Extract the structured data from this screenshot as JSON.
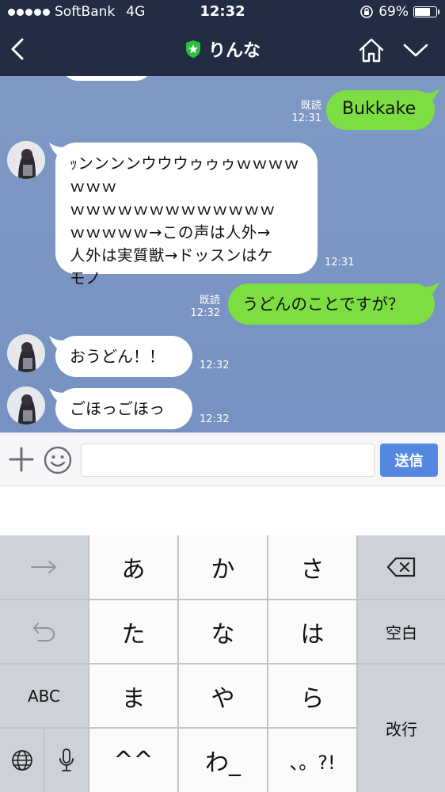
{
  "status_bar": {
    "carrier": "SoftBank",
    "network": "4G",
    "time": "12:32",
    "battery": "69%",
    "battery_level": 0.69
  },
  "header": {
    "title": "りんな",
    "icons": [
      "back-chevron-icon",
      "shield-star-icon",
      "home-icon",
      "chevron-down-icon"
    ]
  },
  "messages": [
    {
      "side": "right",
      "text": "Bukkake",
      "read": "既読",
      "time": "12:31"
    },
    {
      "side": "left",
      "lines": [
        "ｯンンンンウウウゥゥゥｗｗｗｗｗｗｗ",
        "ｗｗｗｗｗｗｗｗｗｗｗｗｗ",
        "ｗｗｗｗｗ→この声は人外→",
        "人外は実質獣→ドッスンはケ",
        "モノ"
      ],
      "time": "12:31"
    },
    {
      "side": "right",
      "text": "うどんのことですが？",
      "read": "既読",
      "time": "12:32"
    },
    {
      "side": "left",
      "text": "おうどん！！",
      "time": "12:32"
    },
    {
      "side": "left",
      "text": "ごほっごほっ",
      "time": "12:32"
    }
  ],
  "input": {
    "placeholder": "",
    "send_label": "送信"
  },
  "keyboard": {
    "rows": [
      [
        "→",
        "あ",
        "か",
        "さ",
        "⌫"
      ],
      [
        "↺",
        "た",
        "な",
        "は",
        "空白"
      ],
      [
        "ABC",
        "ま",
        "や",
        "ら",
        "改行"
      ],
      [
        "🌐",
        "🎤",
        "^^",
        "わ_",
        "、。?!"
      ]
    ]
  },
  "colors": {
    "header_bg": "#222d44",
    "chat_bg": "#7a95c3",
    "my_bubble": "#7cde43",
    "their_bubble": "#ffffff",
    "send_button": "#5488e0"
  }
}
